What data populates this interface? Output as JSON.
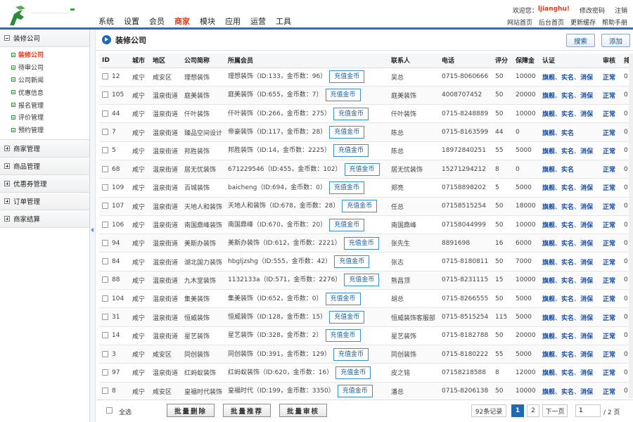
{
  "header": {
    "nav": [
      "系统",
      "设置",
      "会员",
      "商家",
      "模块",
      "应用",
      "运营",
      "工具"
    ],
    "active_nav": "商家",
    "welcome": "欢迎您：",
    "username": "ljianghu!",
    "change_password": "修改密码",
    "logout": "注销",
    "sub_links": [
      "网站首页",
      "后台首页",
      "更新缓存",
      "帮助手册"
    ],
    "accent": "#e23b1c",
    "brand": "#2a6fb5"
  },
  "sidebar": {
    "groups": [
      {
        "label": "装修公司",
        "expanded": true,
        "items": [
          "装修公司",
          "待审公司",
          "公司新闻",
          "优惠信息",
          "报名管理",
          "评价管理",
          "预约管理"
        ],
        "active_item": "装修公司"
      },
      {
        "label": "商家管理",
        "expanded": false
      },
      {
        "label": "商品管理",
        "expanded": false
      },
      {
        "label": "优惠券管理",
        "expanded": false
      },
      {
        "label": "订单管理",
        "expanded": false
      },
      {
        "label": "商家结算",
        "expanded": false
      }
    ]
  },
  "main": {
    "title": "装修公司",
    "search_label": "搜索",
    "add_label": "添加",
    "columns": [
      "ID",
      "城市",
      "地区",
      "公司简称",
      "所属会员",
      "联系人",
      "电话",
      "评分",
      "保障金",
      "认证",
      "审核",
      "排"
    ],
    "recharge_label": "充值金币",
    "rows": [
      {
        "id": "12",
        "city": "咸宁",
        "area": "咸安区",
        "name": "理想装饰",
        "member": "理想装饰（ID:133，金币数：96）",
        "contact": "吴总",
        "phone": "0715-8060666",
        "score": "50",
        "deposit": "10000",
        "cert": [
          "旗舰",
          "实名",
          "消保"
        ],
        "status": "正常",
        "rank": "0"
      },
      {
        "id": "105",
        "city": "咸宁",
        "area": "温泉街道",
        "name": "庭美装饰",
        "member": "庭美装饰（ID:655，金币数：7）",
        "contact": "庭美装饰",
        "phone": "4008707452",
        "score": "50",
        "deposit": "20000",
        "cert": [
          "旗舰",
          "实名",
          "消保"
        ],
        "status": "正常",
        "rank": "0"
      },
      {
        "id": "44",
        "city": "咸宁",
        "area": "温泉街道",
        "name": "仟叶装饰",
        "member": "仟叶装饰（ID:266，金币数：275）",
        "contact": "仟叶装饰",
        "phone": "0715-8248889",
        "score": "50",
        "deposit": "10000",
        "cert": [
          "旗舰",
          "实名",
          "消保"
        ],
        "status": "正常",
        "rank": "0"
      },
      {
        "id": "7",
        "city": "咸宁",
        "area": "温泉街道",
        "name": "臻品空间设计",
        "member": "帝豪装饰（ID:117，金币数：28）",
        "contact": "陈总",
        "phone": "0715-8163599",
        "score": "44",
        "deposit": "0",
        "cert": [
          "旗舰",
          "实名"
        ],
        "status": "正常",
        "rank": "0"
      },
      {
        "id": "5",
        "city": "咸宁",
        "area": "温泉街道",
        "name": "邦胜装饰",
        "member": "邦胜装饰（ID:14，金币数：2225）",
        "contact": "陈总",
        "phone": "18972840251",
        "score": "55",
        "deposit": "5000",
        "cert": [
          "旗舰",
          "实名",
          "消保"
        ],
        "status": "正常",
        "rank": "0"
      },
      {
        "id": "68",
        "city": "咸宁",
        "area": "温泉街道",
        "name": "居无忧装饰",
        "member": "671229546（ID:455，金币数：102）",
        "contact": "居无忧装饰",
        "phone": "15271294212",
        "score": "8",
        "deposit": "0",
        "cert": [
          "旗舰",
          "实名"
        ],
        "status": "正常",
        "rank": "0"
      },
      {
        "id": "109",
        "city": "咸宁",
        "area": "温泉街道",
        "name": "百城装饰",
        "member": "baicheng（ID:694，金币数：0）",
        "contact": "郑亮",
        "phone": "07158898202",
        "score": "5",
        "deposit": "5000",
        "cert": [
          "旗舰",
          "实名",
          "消保"
        ],
        "status": "正常",
        "rank": "0"
      },
      {
        "id": "107",
        "city": "咸宁",
        "area": "温泉街道",
        "name": "天地人和装饰",
        "member": "天地人和装饰（ID:678，金币数：28）",
        "contact": "任总",
        "phone": "07158515254",
        "score": "50",
        "deposit": "18000",
        "cert": [
          "旗舰",
          "实名",
          "消保"
        ],
        "status": "正常",
        "rank": "0"
      },
      {
        "id": "106",
        "city": "咸宁",
        "area": "温泉街道",
        "name": "南国鼎峰装饰",
        "member": "南国鼎峰（ID:670，金币数：20）",
        "contact": "南国鼎峰",
        "phone": "07158044999",
        "score": "50",
        "deposit": "10000",
        "cert": [
          "旗舰",
          "实名",
          "消保"
        ],
        "status": "正常",
        "rank": "0"
      },
      {
        "id": "94",
        "city": "咸宁",
        "area": "温泉街道",
        "name": "美斯办装饰",
        "member": "美斯办装饰（ID:612，金币数：2221）",
        "contact": "张先生",
        "phone": "8891698",
        "score": "16",
        "deposit": "6000",
        "cert": [
          "旗舰",
          "实名",
          "消保"
        ],
        "status": "正常",
        "rank": "0"
      },
      {
        "id": "84",
        "city": "咸宁",
        "area": "温泉街道",
        "name": "湖北国力装饰",
        "member": "hbgljzshg（ID:555，金币数：42）",
        "contact": "张志",
        "phone": "0715-8180811",
        "score": "50",
        "deposit": "7000",
        "cert": [
          "旗舰",
          "实名",
          "消保"
        ],
        "status": "正常",
        "rank": "0"
      },
      {
        "id": "88",
        "city": "咸宁",
        "area": "温泉街道",
        "name": "九木堂装饰",
        "member": "1132133a（ID:571，金币数：2276）",
        "contact": "熊昌顶",
        "phone": "0715-8231115",
        "score": "15",
        "deposit": "10000",
        "cert": [
          "旗舰",
          "实名",
          "消保"
        ],
        "status": "正常",
        "rank": "0"
      },
      {
        "id": "104",
        "city": "咸宁",
        "area": "温泉街道",
        "name": "集美装饰",
        "member": "集美装饰（ID:652，金币数：0）",
        "contact": "胡总",
        "phone": "0715-8266555",
        "score": "50",
        "deposit": "5000",
        "cert": [
          "旗舰",
          "实名",
          "消保"
        ],
        "status": "正常",
        "rank": "0"
      },
      {
        "id": "31",
        "city": "咸宁",
        "area": "温泉街道",
        "name": "恒威装饰",
        "member": "恒威装饰（ID:128，金币数：15）",
        "contact": "恒威装饰客服部",
        "phone": "0715-8515254",
        "score": "115",
        "deposit": "5000",
        "cert": [
          "旗舰",
          "实名",
          "消保"
        ],
        "status": "正常",
        "rank": "0"
      },
      {
        "id": "14",
        "city": "咸宁",
        "area": "温泉街道",
        "name": "星艺装饰",
        "member": "星艺装饰（ID:328，金币数：2）",
        "contact": "星艺装饰",
        "phone": "0715-8182788",
        "score": "50",
        "deposit": "20000",
        "cert": [
          "旗舰",
          "实名",
          "消保"
        ],
        "status": "正常",
        "rank": "0"
      },
      {
        "id": "3",
        "city": "咸宁",
        "area": "咸安区",
        "name": "同创装饰",
        "member": "同创装饰（ID:391，金币数：129）",
        "contact": "同创装饰",
        "phone": "0715-8180222",
        "score": "55",
        "deposit": "5000",
        "cert": [
          "旗舰",
          "实名",
          "消保"
        ],
        "status": "正常",
        "rank": "0"
      },
      {
        "id": "97",
        "city": "咸宁",
        "area": "温泉街道",
        "name": "红蚂蚁装饰",
        "member": "红蚂蚁装饰（ID:620，金币数：16）",
        "contact": "皮之铭",
        "phone": "07158218588",
        "score": "8",
        "deposit": "12000",
        "cert": [
          "旗舰",
          "实名",
          "消保"
        ],
        "status": "正常",
        "rank": "0"
      },
      {
        "id": "8",
        "city": "咸宁",
        "area": "咸安区",
        "name": "皇福时代装饰",
        "member": "皇福时代（ID:199，金币数：3350）",
        "contact": "潘总",
        "phone": "0715-8206138",
        "score": "50",
        "deposit": "10000",
        "cert": [
          "旗舰",
          "实名",
          "消保"
        ],
        "status": "正常",
        "rank": "0"
      }
    ]
  },
  "footer": {
    "select_all": "全选",
    "bulk_delete": "批量删除",
    "bulk_recommend": "批量推荐",
    "bulk_review": "批量审核",
    "records": "92条记录",
    "pages": [
      "1",
      "2"
    ],
    "current_page": "1",
    "next": "下一页",
    "page_input": "1",
    "total_pages": "/ 2 页"
  }
}
